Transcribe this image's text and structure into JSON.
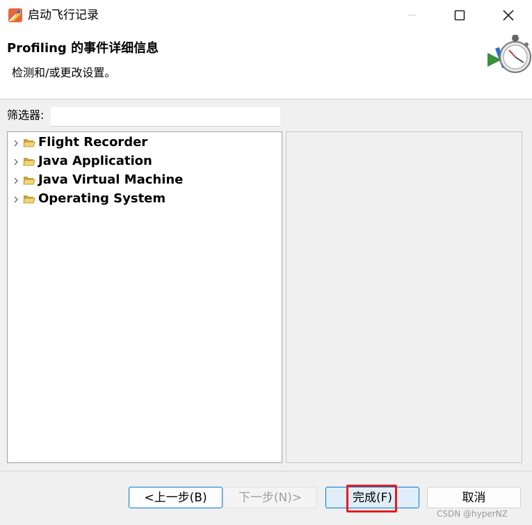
{
  "window": {
    "title": "启动飞行记录",
    "icons": {
      "app": "flight-recorder-app-icon",
      "minimize": "minimize-icon",
      "maximize": "maximize-icon",
      "close": "close-icon"
    }
  },
  "header": {
    "title": "Profiling 的事件详细信息",
    "description": "检测和/或更改设置。",
    "icon": "stopwatch-wizard-icon"
  },
  "filter": {
    "label": "筛选器:",
    "value": ""
  },
  "tree": {
    "items": [
      {
        "label": "Flight Recorder",
        "icon": "folder-icon",
        "expanded": false
      },
      {
        "label": "Java Application",
        "icon": "folder-icon",
        "expanded": false
      },
      {
        "label": "Java Virtual Machine",
        "icon": "folder-icon",
        "expanded": false
      },
      {
        "label": "Operating System",
        "icon": "folder-icon",
        "expanded": false
      }
    ]
  },
  "buttons": {
    "back": "<上一步(B)",
    "next": "下一步(N)>",
    "finish": "完成(F)",
    "cancel": "取消"
  },
  "watermark": "CSDN @hyperNZ",
  "colors": {
    "accent": "#0078d4",
    "highlight": "#e81c1c",
    "folder": "#e8c35a"
  }
}
